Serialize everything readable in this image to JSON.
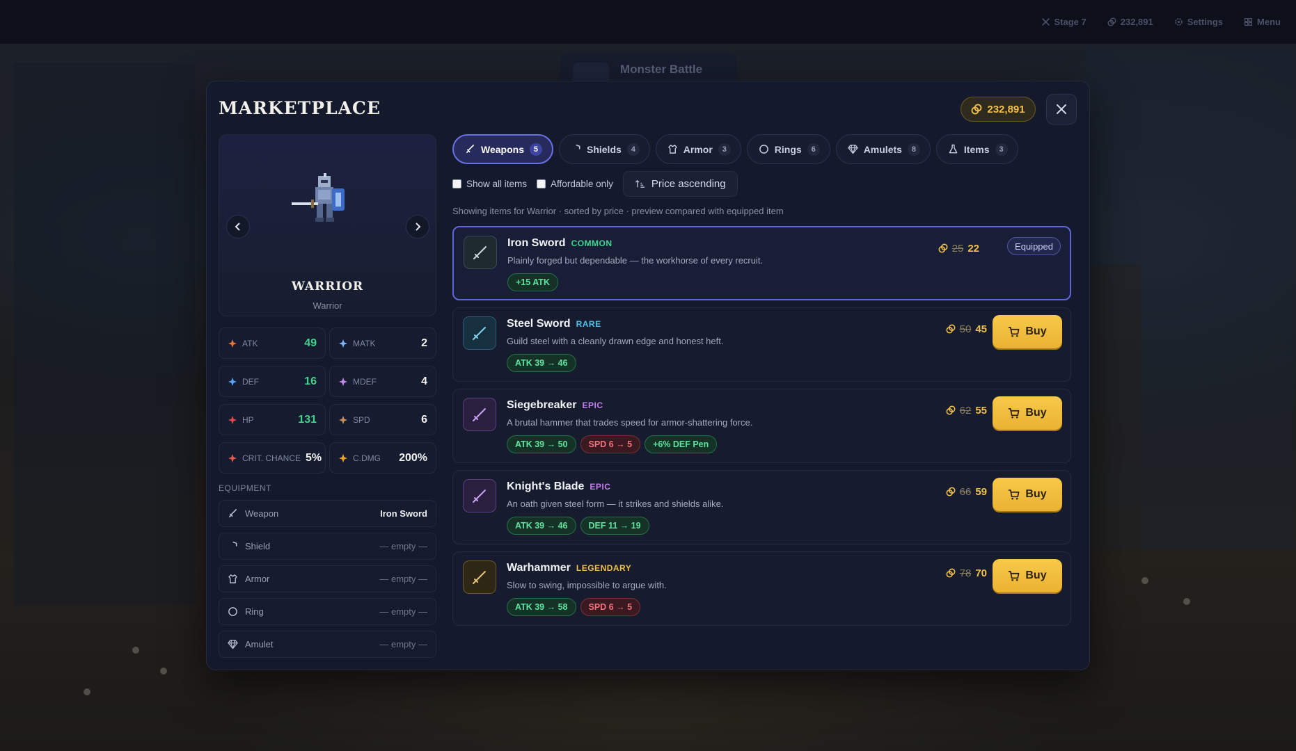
{
  "topbar": {
    "stage": "Stage 7",
    "gold": "232,891",
    "settings": "Settings",
    "menu": "Menu"
  },
  "background_tab": "Monster Battle",
  "modal": {
    "title": "MARKETPLACE",
    "gold": "232,891"
  },
  "hero": {
    "name": "WARRIOR",
    "class": "Warrior"
  },
  "stats": [
    {
      "icon": "sword-burst-icon",
      "label": "ATK",
      "value": "49",
      "tone": "green"
    },
    {
      "icon": "magic-star-icon",
      "label": "MATK",
      "value": "2",
      "tone": "white"
    },
    {
      "icon": "shield-icon",
      "label": "DEF",
      "value": "16",
      "tone": "green"
    },
    {
      "icon": "magic-shield-icon",
      "label": "MDEF",
      "value": "4",
      "tone": "white"
    },
    {
      "icon": "heart-icon",
      "label": "HP",
      "value": "131",
      "tone": "green"
    },
    {
      "icon": "boot-icon",
      "label": "SPD",
      "value": "6",
      "tone": "white"
    },
    {
      "icon": "crit-target-icon",
      "label": "CRIT. CHANCE",
      "value": "5%",
      "tone": "white"
    },
    {
      "icon": "explosion-icon",
      "label": "C.DMG",
      "value": "200%",
      "tone": "white"
    }
  ],
  "equipment": {
    "heading": "EQUIPMENT",
    "slots": [
      {
        "icon": "sword-icon",
        "label": "Weapon",
        "value": "Iron Sword",
        "filled": true
      },
      {
        "icon": "shield-icon",
        "label": "Shield",
        "value": "— empty —",
        "filled": false
      },
      {
        "icon": "armor-icon",
        "label": "Armor",
        "value": "— empty —",
        "filled": false
      },
      {
        "icon": "ring-icon",
        "label": "Ring",
        "value": "— empty —",
        "filled": false
      },
      {
        "icon": "gem-icon",
        "label": "Amulet",
        "value": "— empty —",
        "filled": false
      }
    ]
  },
  "tabs": [
    {
      "icon": "sword-icon",
      "label": "Weapons",
      "count": "5",
      "active": true
    },
    {
      "icon": "shield-icon",
      "label": "Shields",
      "count": "4",
      "active": false
    },
    {
      "icon": "armor-icon",
      "label": "Armor",
      "count": "3",
      "active": false
    },
    {
      "icon": "ring-icon",
      "label": "Rings",
      "count": "6",
      "active": false
    },
    {
      "icon": "gem-icon",
      "label": "Amulets",
      "count": "8",
      "active": false
    },
    {
      "icon": "flask-icon",
      "label": "Items",
      "count": "3",
      "active": false
    }
  ],
  "filters": {
    "show_all": "Show all items",
    "affordable": "Affordable only",
    "sort": "Price ascending"
  },
  "caption": "Showing items for Warrior · sorted by price · preview compared with equipped item",
  "items": [
    {
      "name": "Iron Sword",
      "rarity": "COMMON",
      "rarity_class": "common",
      "desc": "Plainly forged but dependable — the workhorse of every recruit.",
      "old_price": "25",
      "price": "22",
      "equipped": true,
      "equipped_label": "Equipped",
      "tags": [
        {
          "text": "+15 ATK",
          "kind": "up"
        }
      ]
    },
    {
      "name": "Steel Sword",
      "rarity": "RARE",
      "rarity_class": "rare",
      "desc": "Guild steel with a cleanly drawn edge and honest heft.",
      "old_price": "50",
      "price": "45",
      "equipped": false,
      "buy_label": "Buy",
      "tags": [
        {
          "text": "ATK 39 → 46",
          "kind": "up"
        }
      ]
    },
    {
      "name": "Siegebreaker",
      "rarity": "EPIC",
      "rarity_class": "epic",
      "desc": "A brutal hammer that trades speed for armor-shattering force.",
      "old_price": "62",
      "price": "55",
      "equipped": false,
      "buy_label": "Buy",
      "tags": [
        {
          "text": "ATK 39 → 50",
          "kind": "up"
        },
        {
          "text": "SPD 6 → 5",
          "kind": "down"
        },
        {
          "text": "+6% DEF Pen",
          "kind": "up"
        }
      ]
    },
    {
      "name": "Knight's Blade",
      "rarity": "EPIC",
      "rarity_class": "epic",
      "desc": "An oath given steel form — it strikes and shields alike.",
      "old_price": "66",
      "price": "59",
      "equipped": false,
      "buy_label": "Buy",
      "tags": [
        {
          "text": "ATK 39 → 46",
          "kind": "up"
        },
        {
          "text": "DEF 11 → 19",
          "kind": "up"
        }
      ]
    },
    {
      "name": "Warhammer",
      "rarity": "LEGENDARY",
      "rarity_class": "legendary",
      "desc": "Slow to swing, impossible to argue with.",
      "old_price": "78",
      "price": "70",
      "equipped": false,
      "buy_label": "Buy",
      "tags": [
        {
          "text": "ATK 39 → 58",
          "kind": "up"
        },
        {
          "text": "SPD 6 → 5",
          "kind": "down"
        }
      ]
    }
  ]
}
